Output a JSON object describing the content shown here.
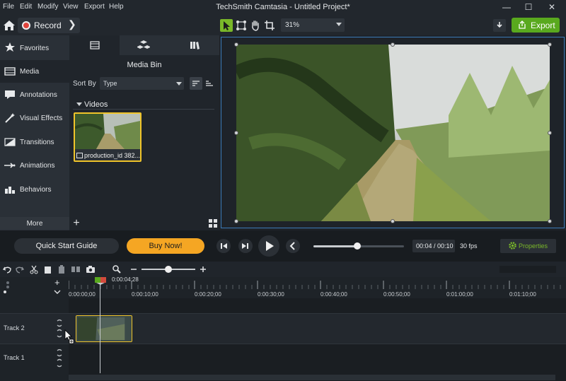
{
  "menu": [
    "File",
    "Edit",
    "Modify",
    "View",
    "Export",
    "Help"
  ],
  "window": {
    "title": "TechSmith Camtasia - Untitled Project*",
    "minimize": "—",
    "maximize": "☐",
    "close": "✕"
  },
  "toolbar": {
    "record_label": "Record",
    "zoom": "31%",
    "export_label": "Export"
  },
  "sidebar": {
    "items": [
      "Favorites",
      "Media",
      "Annotations",
      "Visual Effects",
      "Transitions",
      "Animations",
      "Behaviors"
    ],
    "active": "Media",
    "more_label": "More"
  },
  "media_bin": {
    "title": "Media Bin",
    "sort_by_label": "Sort By",
    "sort_value": "Type",
    "group_label": "Videos",
    "item_label": "production_id 382..."
  },
  "playback": {
    "quick_start_label": "Quick Start Guide",
    "buy_label": "Buy Now!",
    "time": "00:04 / 00:10",
    "fps": "30 fps",
    "properties_label": "Properties",
    "progress": 0.4
  },
  "timeline": {
    "playhead_time": "0:00:04;28",
    "ticks": [
      "0:00:00;00",
      "0:00:10;00",
      "0:00:20;00",
      "0:00:30;00",
      "0:00:40;00",
      "0:00:50;00",
      "0:01:00;00",
      "0:01:10;00"
    ],
    "tracks": [
      "Track 2",
      "Track 1"
    ]
  },
  "colors": {
    "accent_green": "#59a91e",
    "selection_yellow": "#f0c42a",
    "buy_orange": "#f5a623"
  }
}
